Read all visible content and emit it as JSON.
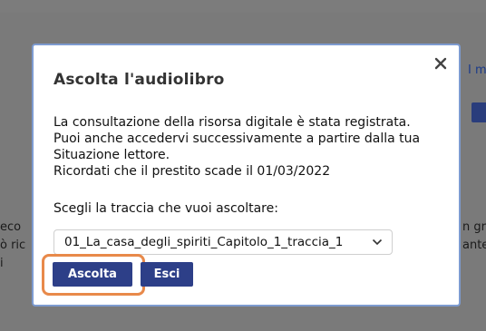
{
  "background": {
    "left_lines": [
      "eco",
      "ò ric",
      "i"
    ],
    "right_lines": [
      "n gra",
      "ante"
    ],
    "top_right_link": "I m"
  },
  "modal": {
    "title": "Ascolta l'audiolibro",
    "close_symbol": "✕",
    "message_lines": [
      "La consultazione della risorsa digitale è stata registrata.",
      "Puoi anche accedervi successivamente a partire dalla tua",
      "Situazione lettore.",
      "Ricordati che il prestito scade il 01/03/2022"
    ],
    "track_label": "Scegli la traccia che vuoi ascoltare:",
    "track_selected": "01_La_casa_degli_spiriti_Capitolo_1_traccia_1",
    "listen_button": "Ascolta",
    "exit_button": "Esci"
  },
  "colors": {
    "primary_button": "#2d3f88",
    "highlight": "#e8894a",
    "modal_border": "#7d9bd0"
  }
}
